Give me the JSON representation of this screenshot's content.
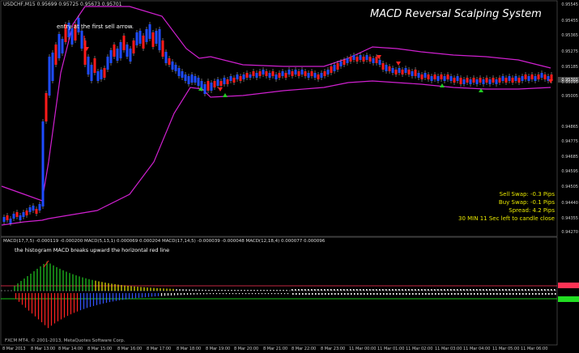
{
  "symbol_line": "USDCHF,M15  0.95699 0.95725 0.95673 0.95701",
  "title": "MACD Reversal Scalping System",
  "annotation_entry": "entry at the first sell arrow.",
  "annotation_hist": "the histogram MACD breaks upward the horizontal red line",
  "macd_header": "MACD(17,7,5) -0.000119 -0.000200   MACD(5,13,1) 0.000069 0.000204   MACD(17,14,5) -0.000039 -0.000048   MACD(12,18,4) 0.000077 0.000096",
  "copyright": "FXCM MT4, © 2001-2013, MetaQuotes Software Corp.",
  "info": {
    "sell_swap": "Sell Swap: -0.3 Pips",
    "buy_swap": "Buy Swap: -0.1 Pips",
    "spread": "Spread: 4.2 Pips",
    "candle": "30 MIN 11 Sec left to candle close"
  },
  "price_labels": [
    "0.95545",
    "0.95455",
    "0.95365",
    "0.95275",
    "0.95185",
    "0.95095",
    "0.95005",
    "0.94865",
    "0.94775",
    "0.94685",
    "0.94595",
    "0.94505",
    "0.94440",
    "0.94355",
    "0.94270"
  ],
  "time_labels": [
    "8 Mar 2013",
    "8 Mar 13:00",
    "8 Mar 14:00",
    "8 Mar 15:00",
    "8 Mar 16:00",
    "8 Mar 17:00",
    "8 Mar 18:00",
    "8 Mar 19:00",
    "8 Mar 20:00",
    "8 Mar 21:00",
    "8 Mar 22:00",
    "8 Mar 23:00",
    "11 Mar 00:00",
    "11 Mar 01:00",
    "11 Mar 02:00",
    "11 Mar 03:00",
    "11 Mar 04:00",
    "11 Mar 05:00",
    "11 Mar 06:00"
  ],
  "current_price_tag": "0.95301",
  "colors": {
    "bull": "#1e4cff",
    "bear": "#ff1a1a",
    "band": "#d020d0",
    "buy_arrow": "#22cc22",
    "sell_arrow": "#ff2222",
    "info": "#e8e800"
  }
}
